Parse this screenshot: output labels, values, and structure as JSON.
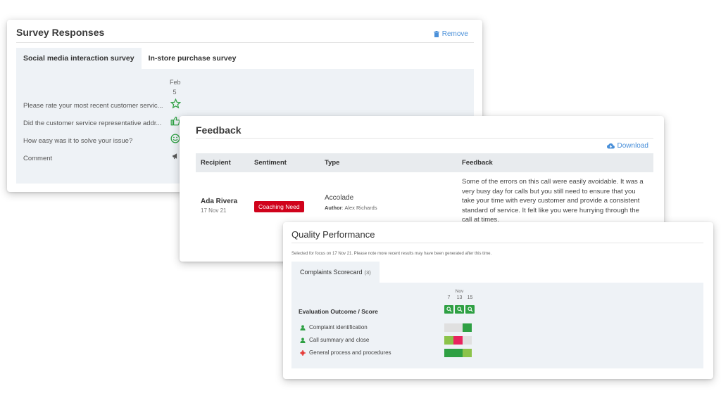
{
  "colors": {
    "accent_blue": "#4a90d9",
    "panel_bg": "#eef2f6",
    "badge_red": "#d0021b",
    "score_green": "#2ea043",
    "score_light_green": "#8bc34a",
    "score_red": "#e8245f",
    "score_grey": "#e0e0e0",
    "person_green": "#2ea043",
    "gear_red": "#e53935"
  },
  "survey": {
    "title": "Survey Responses",
    "remove_label": "Remove",
    "tabs": [
      {
        "label": "Social media interaction survey",
        "active": true
      },
      {
        "label": "In-store purchase survey",
        "active": false
      }
    ],
    "date_month": "Feb",
    "date_day": "5",
    "questions": [
      {
        "text": "Please rate your most recent customer servic...",
        "icon": "star-outline-icon"
      },
      {
        "text": "Did the customer service representative addr...",
        "icon": "thumbs-up-icon"
      },
      {
        "text": "How easy was it to solve your issue?",
        "icon": "smiley-icon"
      },
      {
        "text": "Comment",
        "icon": "megaphone-icon"
      }
    ]
  },
  "feedback": {
    "title": "Feedback",
    "download_label": "Download",
    "columns": [
      "Recipient",
      "Sentiment",
      "Type",
      "Feedback"
    ],
    "row": {
      "recipient": "Ada Rivera",
      "date": "17 Nov 21",
      "sentiment": "Coaching Need",
      "type": "Accolade",
      "author_label": "Author",
      "author_name": ": Alex Richards",
      "text": "Some of the errors on this call were easily avoidable. It was a very busy day for calls but you still need to ensure that you take your time with every customer and provide a consistent standard of service. It felt like you were hurrying through the call at times."
    }
  },
  "quality": {
    "title": "Quality Performance",
    "note": "Selected for focus on 17 Nov 21. Please note more recent results may have been generated after this time.",
    "tab_label": "Complaints Scorecard",
    "tab_count": "(3)",
    "month": "Nov",
    "days": [
      "7",
      "13",
      "15"
    ],
    "eval_label": "Evaluation Outcome / Score",
    "criteria": [
      {
        "label": "Complaint identification",
        "icon": "person-icon",
        "scores": [
          "grey",
          "grey",
          "green"
        ]
      },
      {
        "label": "Call summary and close",
        "icon": "person-icon",
        "scores": [
          "light_green",
          "red",
          "grey"
        ]
      },
      {
        "label": "General process and procedures",
        "icon": "gear-icon",
        "scores": [
          "green",
          "green",
          "light_green"
        ]
      }
    ]
  }
}
